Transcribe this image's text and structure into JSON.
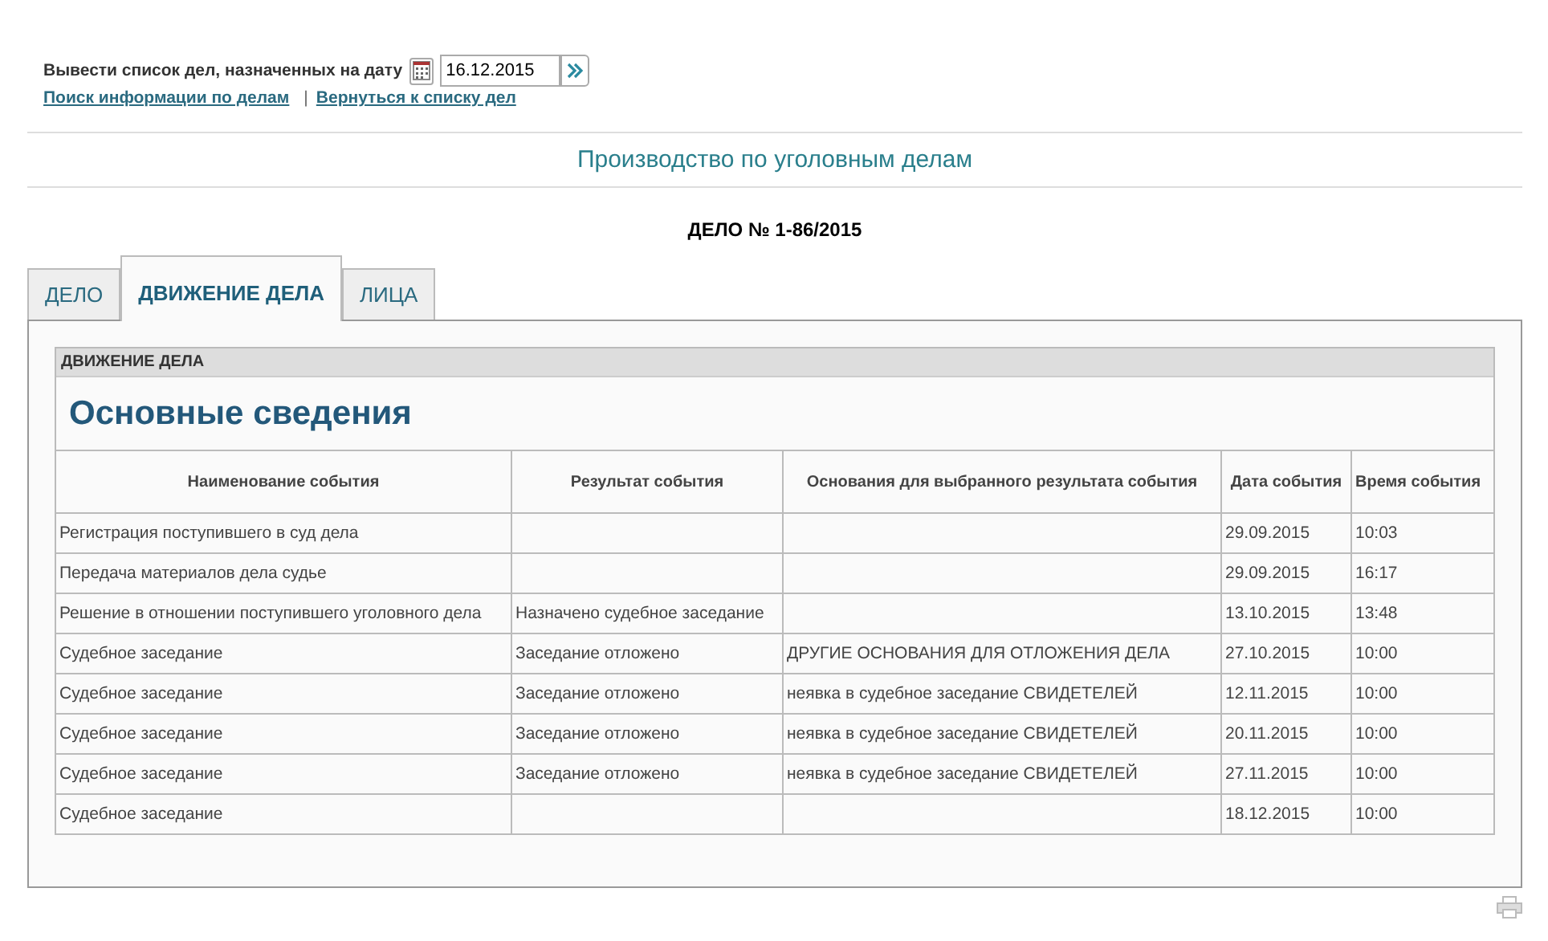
{
  "date_filter": {
    "label": "Вывести список дел, назначенных на дату",
    "value": "16.12.2015"
  },
  "links": [
    {
      "text": "Поиск информации по делам"
    },
    {
      "text": "Вернуться к списку дел"
    }
  ],
  "link_separator": "|",
  "section_title": "Производство по уголовным делам",
  "case_title": "ДЕЛО № 1-86/2015",
  "tabs": [
    {
      "label": "ДЕЛО",
      "selected": false
    },
    {
      "label": "ДВИЖЕНИЕ ДЕЛА",
      "selected": true
    },
    {
      "label": "ЛИЦА",
      "selected": false
    }
  ],
  "panel": {
    "header": "ДВИЖЕНИЕ ДЕЛА",
    "heading": "Основные сведения",
    "table": {
      "columns": [
        "Наименование события",
        "Результат события",
        "Основания для выбранного результата события",
        "Дата события",
        "Время события"
      ],
      "rows": [
        {
          "event": "Регистрация поступившего в суд дела",
          "date": "29.09.2015",
          "time": "10:03"
        },
        {
          "event": "Передача материалов дела судье",
          "date": "29.09.2015",
          "time": "16:17"
        },
        {
          "event": "Решение в отношении поступившего уголовного дела",
          "result": "Назначено судебное заседание",
          "date": "13.10.2015",
          "time": "13:48"
        },
        {
          "event": "Судебное заседание",
          "result": "Заседание отложено",
          "basis": "ДРУГИЕ ОСНОВАНИЯ ДЛЯ ОТЛОЖЕНИЯ ДЕЛА",
          "date": "27.10.2015",
          "time": "10:00"
        },
        {
          "event": "Судебное заседание",
          "result": "Заседание отложено",
          "basis": "неявка в судебное заседание СВИДЕТЕЛЕЙ",
          "date": "12.11.2015",
          "time": "10:00"
        },
        {
          "event": "Судебное заседание",
          "result": "Заседание отложено",
          "basis": "неявка в судебное заседание СВИДЕТЕЛЕЙ",
          "date": "20.11.2015",
          "time": "10:00"
        },
        {
          "event": "Судебное заседание",
          "result": "Заседание отложено",
          "basis": "неявка в судебное заседание СВИДЕТЕЛЕЙ",
          "date": "27.11.2015",
          "time": "10:00"
        },
        {
          "event": "Судебное заседание",
          "date": "18.12.2015",
          "time": "10:00"
        }
      ]
    }
  }
}
